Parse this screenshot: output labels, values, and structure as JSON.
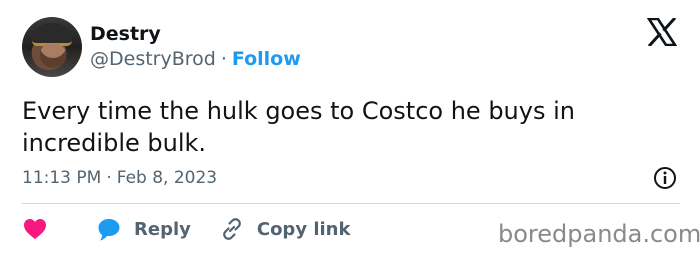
{
  "author": {
    "display_name": "Destry",
    "handle": "@DestryBrod",
    "separator": "·",
    "follow_label": "Follow"
  },
  "tweet": {
    "text": "Every time the hulk goes to Costco he buys in incredible bulk.",
    "time": "11:13 PM",
    "meta_separator": "·",
    "date": "Feb 8, 2023"
  },
  "actions": {
    "reply_label": "Reply",
    "copy_link_label": "Copy link"
  },
  "watermark": "boredpanda.com",
  "colors": {
    "text_primary": "#0f1419",
    "text_secondary": "#536471",
    "accent_blue": "#1d9bf0",
    "like_pink": "#f91880",
    "divider": "#cfd9de"
  },
  "icons": {
    "brand": "x-logo-icon",
    "info": "info-icon",
    "like": "heart-icon",
    "reply": "speech-bubble-icon",
    "copy": "link-icon"
  }
}
